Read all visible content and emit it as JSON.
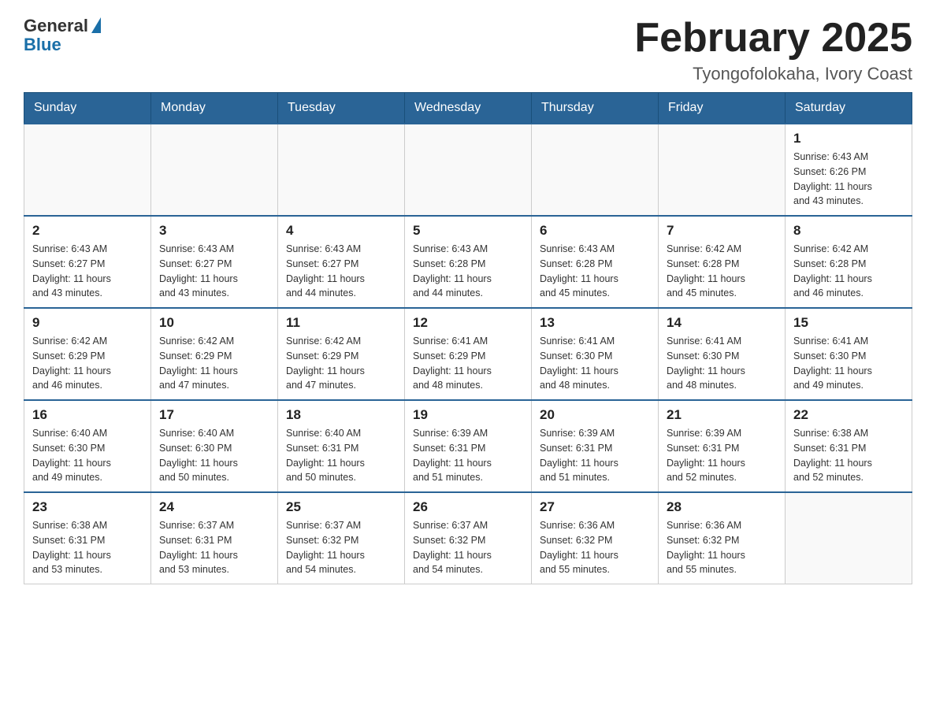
{
  "header": {
    "logo_general": "General",
    "logo_blue": "Blue",
    "month_title": "February 2025",
    "location": "Tyongofolokaha, Ivory Coast"
  },
  "days_of_week": [
    "Sunday",
    "Monday",
    "Tuesday",
    "Wednesday",
    "Thursday",
    "Friday",
    "Saturday"
  ],
  "weeks": [
    [
      {
        "day": "",
        "info": ""
      },
      {
        "day": "",
        "info": ""
      },
      {
        "day": "",
        "info": ""
      },
      {
        "day": "",
        "info": ""
      },
      {
        "day": "",
        "info": ""
      },
      {
        "day": "",
        "info": ""
      },
      {
        "day": "1",
        "info": "Sunrise: 6:43 AM\nSunset: 6:26 PM\nDaylight: 11 hours\nand 43 minutes."
      }
    ],
    [
      {
        "day": "2",
        "info": "Sunrise: 6:43 AM\nSunset: 6:27 PM\nDaylight: 11 hours\nand 43 minutes."
      },
      {
        "day": "3",
        "info": "Sunrise: 6:43 AM\nSunset: 6:27 PM\nDaylight: 11 hours\nand 43 minutes."
      },
      {
        "day": "4",
        "info": "Sunrise: 6:43 AM\nSunset: 6:27 PM\nDaylight: 11 hours\nand 44 minutes."
      },
      {
        "day": "5",
        "info": "Sunrise: 6:43 AM\nSunset: 6:28 PM\nDaylight: 11 hours\nand 44 minutes."
      },
      {
        "day": "6",
        "info": "Sunrise: 6:43 AM\nSunset: 6:28 PM\nDaylight: 11 hours\nand 45 minutes."
      },
      {
        "day": "7",
        "info": "Sunrise: 6:42 AM\nSunset: 6:28 PM\nDaylight: 11 hours\nand 45 minutes."
      },
      {
        "day": "8",
        "info": "Sunrise: 6:42 AM\nSunset: 6:28 PM\nDaylight: 11 hours\nand 46 minutes."
      }
    ],
    [
      {
        "day": "9",
        "info": "Sunrise: 6:42 AM\nSunset: 6:29 PM\nDaylight: 11 hours\nand 46 minutes."
      },
      {
        "day": "10",
        "info": "Sunrise: 6:42 AM\nSunset: 6:29 PM\nDaylight: 11 hours\nand 47 minutes."
      },
      {
        "day": "11",
        "info": "Sunrise: 6:42 AM\nSunset: 6:29 PM\nDaylight: 11 hours\nand 47 minutes."
      },
      {
        "day": "12",
        "info": "Sunrise: 6:41 AM\nSunset: 6:29 PM\nDaylight: 11 hours\nand 48 minutes."
      },
      {
        "day": "13",
        "info": "Sunrise: 6:41 AM\nSunset: 6:30 PM\nDaylight: 11 hours\nand 48 minutes."
      },
      {
        "day": "14",
        "info": "Sunrise: 6:41 AM\nSunset: 6:30 PM\nDaylight: 11 hours\nand 48 minutes."
      },
      {
        "day": "15",
        "info": "Sunrise: 6:41 AM\nSunset: 6:30 PM\nDaylight: 11 hours\nand 49 minutes."
      }
    ],
    [
      {
        "day": "16",
        "info": "Sunrise: 6:40 AM\nSunset: 6:30 PM\nDaylight: 11 hours\nand 49 minutes."
      },
      {
        "day": "17",
        "info": "Sunrise: 6:40 AM\nSunset: 6:30 PM\nDaylight: 11 hours\nand 50 minutes."
      },
      {
        "day": "18",
        "info": "Sunrise: 6:40 AM\nSunset: 6:31 PM\nDaylight: 11 hours\nand 50 minutes."
      },
      {
        "day": "19",
        "info": "Sunrise: 6:39 AM\nSunset: 6:31 PM\nDaylight: 11 hours\nand 51 minutes."
      },
      {
        "day": "20",
        "info": "Sunrise: 6:39 AM\nSunset: 6:31 PM\nDaylight: 11 hours\nand 51 minutes."
      },
      {
        "day": "21",
        "info": "Sunrise: 6:39 AM\nSunset: 6:31 PM\nDaylight: 11 hours\nand 52 minutes."
      },
      {
        "day": "22",
        "info": "Sunrise: 6:38 AM\nSunset: 6:31 PM\nDaylight: 11 hours\nand 52 minutes."
      }
    ],
    [
      {
        "day": "23",
        "info": "Sunrise: 6:38 AM\nSunset: 6:31 PM\nDaylight: 11 hours\nand 53 minutes."
      },
      {
        "day": "24",
        "info": "Sunrise: 6:37 AM\nSunset: 6:31 PM\nDaylight: 11 hours\nand 53 minutes."
      },
      {
        "day": "25",
        "info": "Sunrise: 6:37 AM\nSunset: 6:32 PM\nDaylight: 11 hours\nand 54 minutes."
      },
      {
        "day": "26",
        "info": "Sunrise: 6:37 AM\nSunset: 6:32 PM\nDaylight: 11 hours\nand 54 minutes."
      },
      {
        "day": "27",
        "info": "Sunrise: 6:36 AM\nSunset: 6:32 PM\nDaylight: 11 hours\nand 55 minutes."
      },
      {
        "day": "28",
        "info": "Sunrise: 6:36 AM\nSunset: 6:32 PM\nDaylight: 11 hours\nand 55 minutes."
      },
      {
        "day": "",
        "info": ""
      }
    ]
  ]
}
